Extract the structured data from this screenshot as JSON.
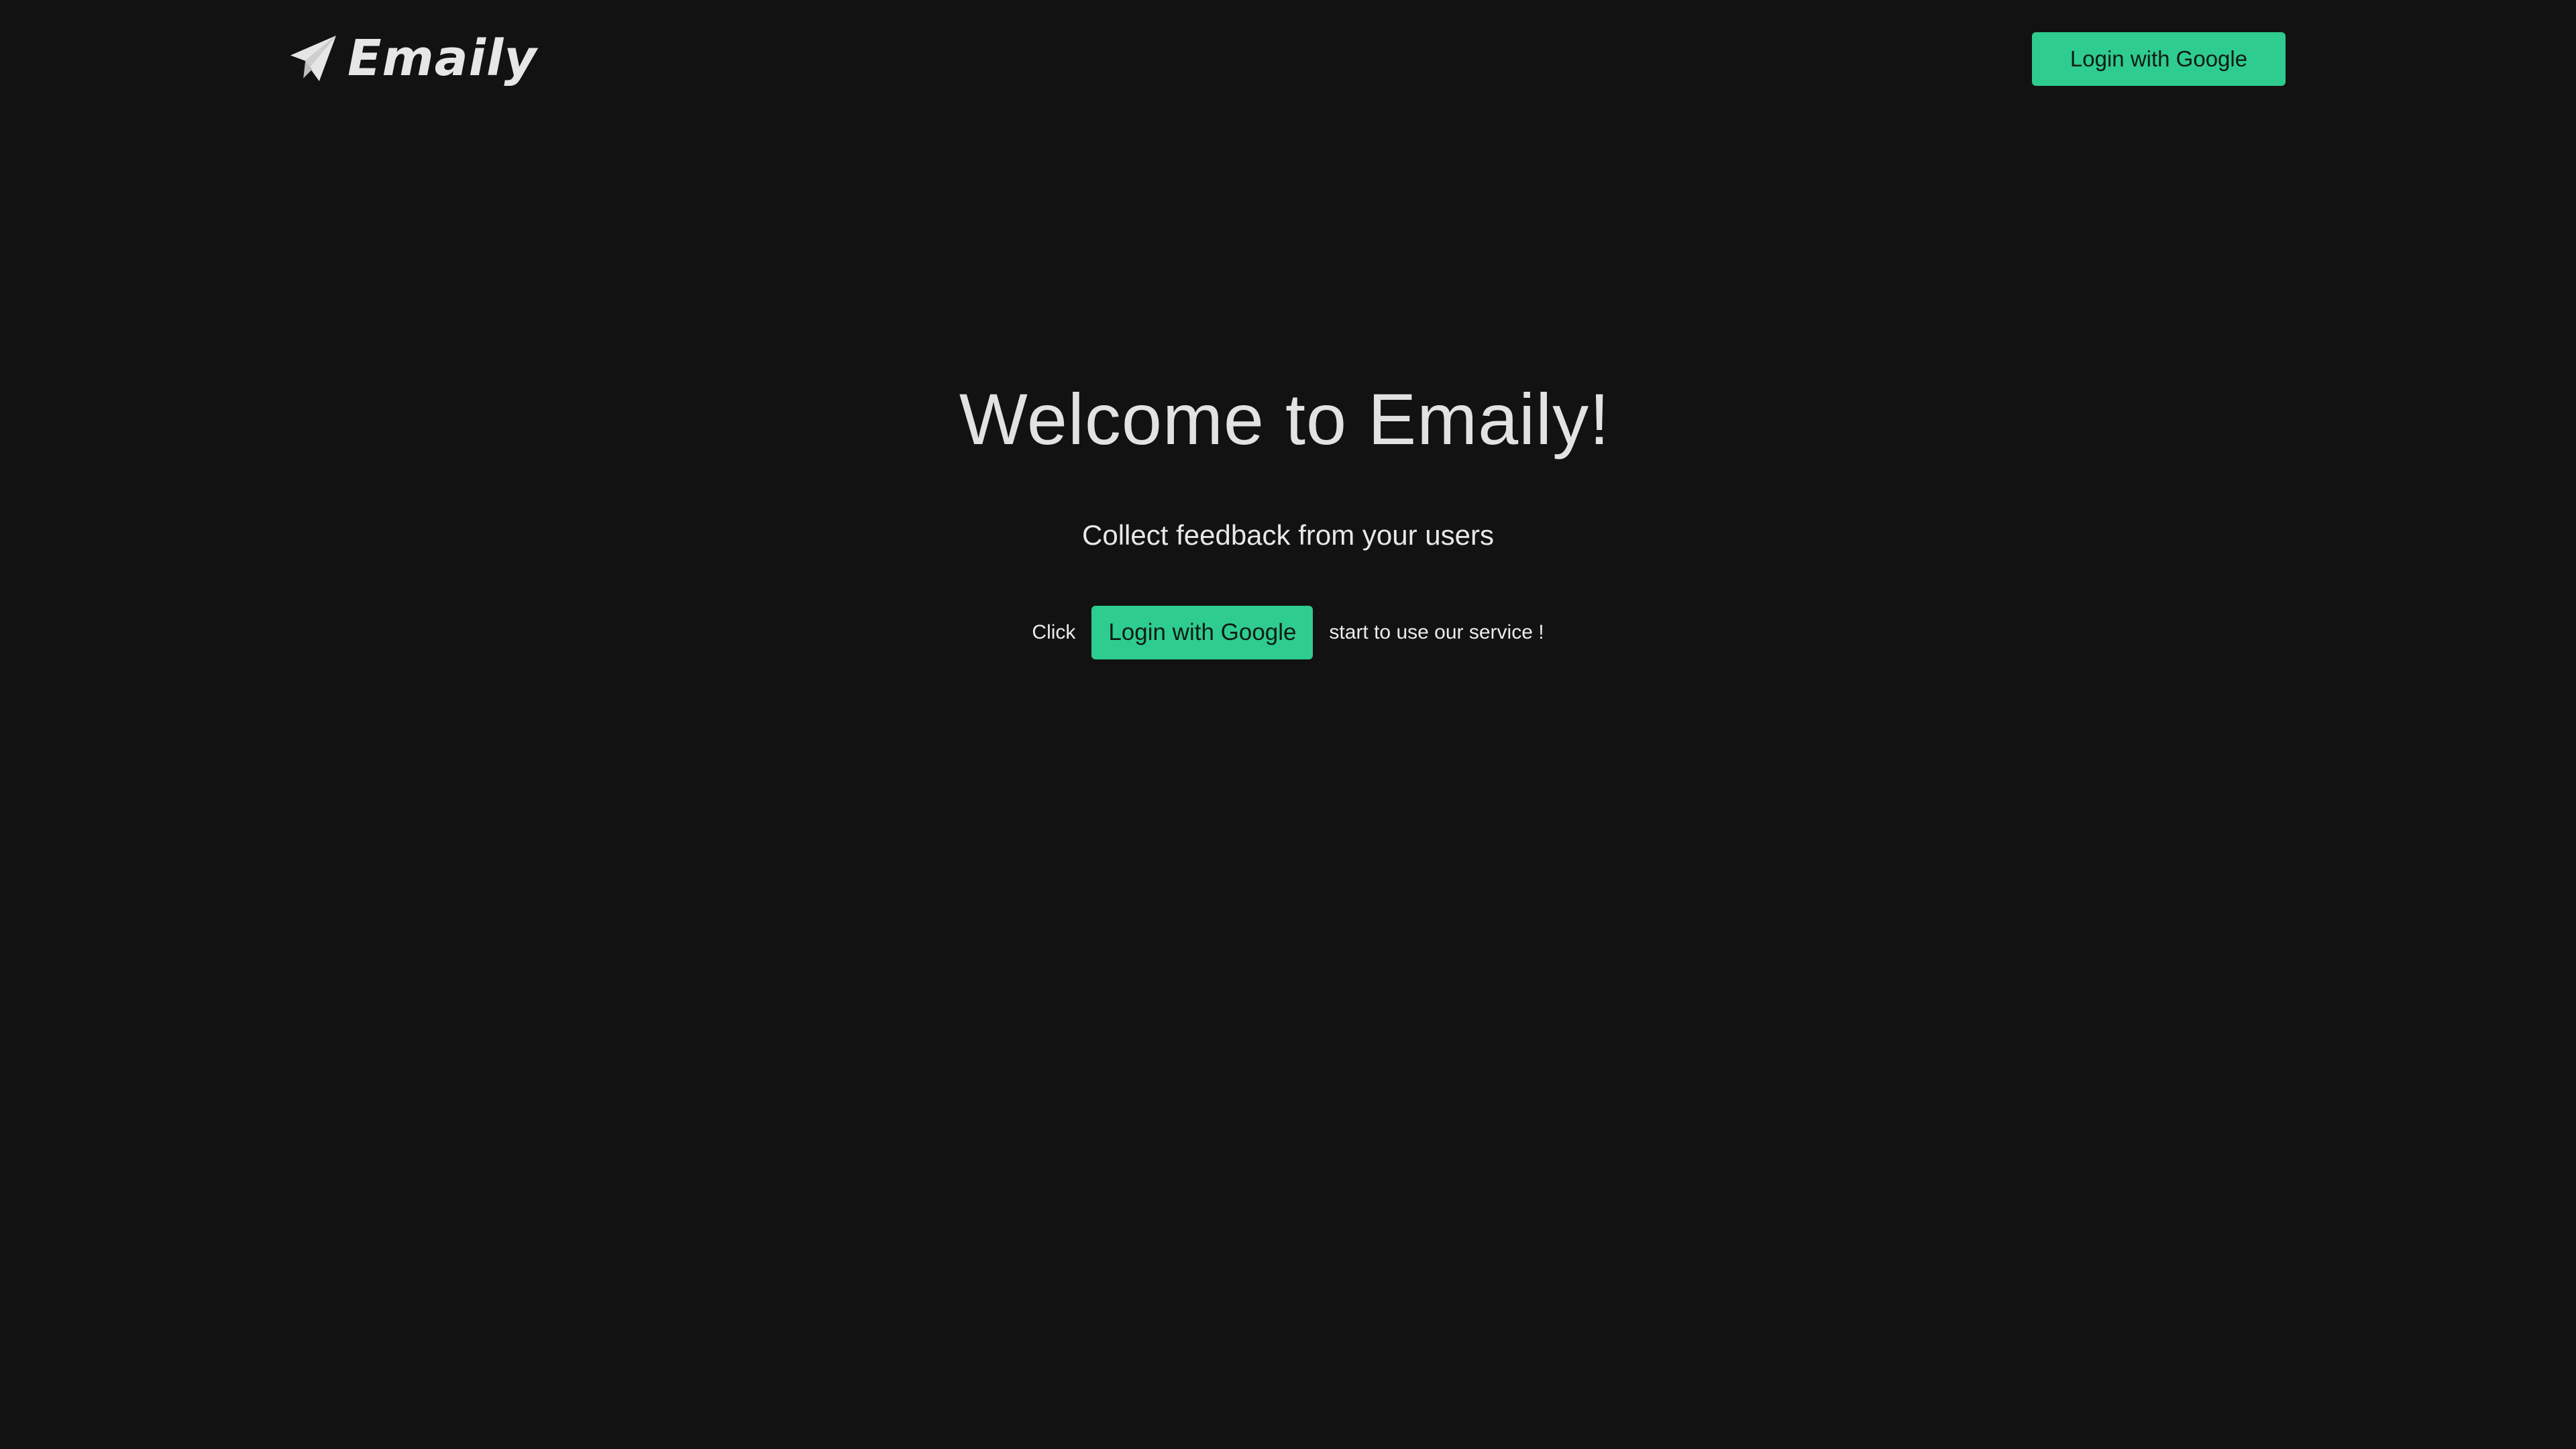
{
  "header": {
    "brand": "Emaily",
    "login_label": "Login with Google",
    "logo_icon": "paper-plane-icon"
  },
  "hero": {
    "title": "Welcome to Emaily!",
    "subtitle": "Collect feedback from your users",
    "cta_prefix": "Click",
    "cta_button_label": "Login with Google",
    "cta_suffix": "start to use our service !"
  },
  "colors": {
    "background": "#121212",
    "accent": "#2ecc8f",
    "text": "#e2e2e2"
  }
}
